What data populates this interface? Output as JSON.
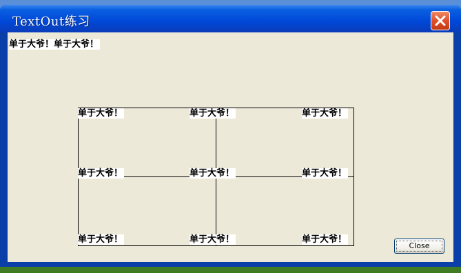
{
  "window": {
    "title": "TextOut练习",
    "close_icon": "close-x-icon"
  },
  "client": {
    "header_text": "单于大爷！单于大爷！",
    "grid_label": "单于大爷！",
    "grid_cells": [
      "单于大爷！",
      "单于大爷！",
      "单于大爷！",
      "单于大爷！",
      "单于大爷！",
      "单于大爷！",
      "单于大爷！",
      "单于大爷！",
      "单于大爷！"
    ],
    "close_button": "Close"
  },
  "colors": {
    "title_bar": "#0048d8",
    "client_bg": "#ece9d8",
    "close_red": "#e0502a"
  }
}
